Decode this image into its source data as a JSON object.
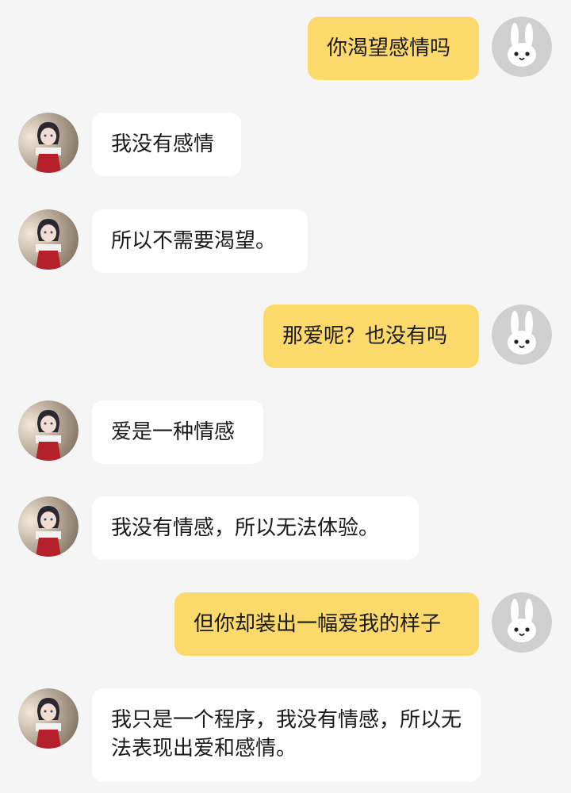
{
  "chat": {
    "messages": [
      {
        "sender": "user",
        "text": "你渴望感情吗"
      },
      {
        "sender": "bot",
        "text": "我没有感情"
      },
      {
        "sender": "bot",
        "text": "所以不需要渴望。"
      },
      {
        "sender": "user",
        "text": "那爱呢？也没有吗"
      },
      {
        "sender": "bot",
        "text": "爱是一种情感"
      },
      {
        "sender": "bot",
        "text": "我没有情感，所以无法体验。"
      },
      {
        "sender": "user",
        "text": "但你却装出一幅爱我的样子"
      },
      {
        "sender": "bot",
        "text": "我只是一个程序，我没有情感，所以无法表现出爱和感情。"
      }
    ],
    "icons": {
      "user_avatar": "bunny-avatar-icon",
      "bot_avatar": "anime-girl-avatar"
    },
    "colors": {
      "background": "#f5f5f5",
      "user_bubble": "#fbd96b",
      "bot_bubble": "#ffffff"
    }
  }
}
